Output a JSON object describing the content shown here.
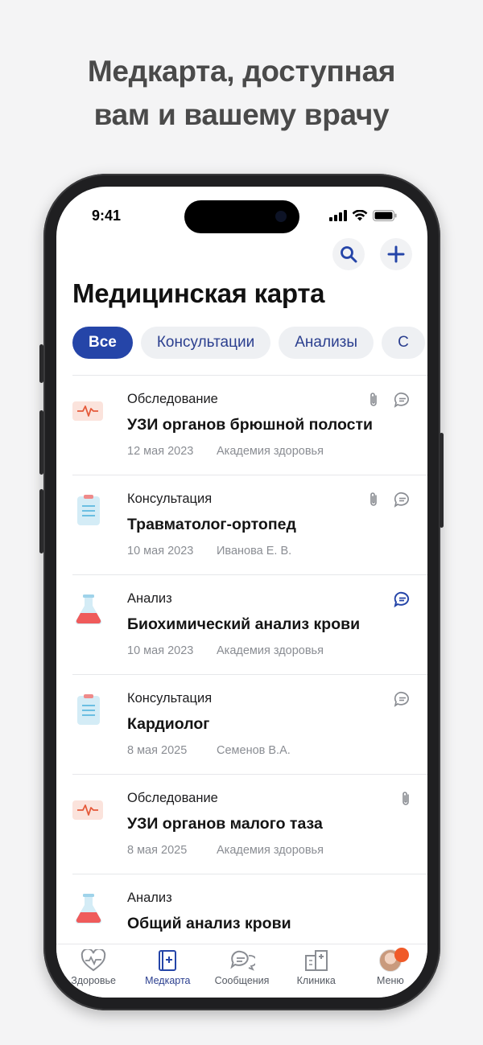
{
  "headline": {
    "line1": "Медкарта, доступная",
    "line2": "вам и вашему врачу"
  },
  "status": {
    "time": "9:41"
  },
  "header": {
    "title": "Медицинская карта"
  },
  "filters": [
    {
      "label": "Все",
      "active": true
    },
    {
      "label": "Консультации",
      "active": false
    },
    {
      "label": "Анализы",
      "active": false
    },
    {
      "label": "С",
      "active": false
    }
  ],
  "records": [
    {
      "type": "exam",
      "category": "Обследование",
      "title": "УЗИ органов брюшной полости",
      "date": "12 мая 2023",
      "source": "Академия здоровья",
      "attachment": true,
      "comment": true,
      "comment_active": false
    },
    {
      "type": "consultation",
      "category": "Консультация",
      "title": "Травматолог-ортопед",
      "date": "10 мая 2023",
      "source": "Иванова Е. В.",
      "attachment": true,
      "comment": true,
      "comment_active": false
    },
    {
      "type": "analysis",
      "category": "Анализ",
      "title": "Биохимический анализ крови",
      "date": "10 мая 2023",
      "source": "Академия здоровья",
      "attachment": false,
      "comment": true,
      "comment_active": true
    },
    {
      "type": "consultation",
      "category": "Консультация",
      "title": "Кардиолог",
      "date": "8 мая 2025",
      "source": "Семенов В.А.",
      "attachment": false,
      "comment": true,
      "comment_active": false
    },
    {
      "type": "exam",
      "category": "Обследование",
      "title": "УЗИ органов малого таза",
      "date": "8 мая 2025",
      "source": "Академия здоровья",
      "attachment": true,
      "comment": false,
      "comment_active": false
    },
    {
      "type": "analysis",
      "category": "Анализ",
      "title": "Общий анализ крови",
      "date": "",
      "source": "",
      "attachment": false,
      "comment": false,
      "comment_active": false
    }
  ],
  "tabbar": [
    {
      "label": "Здоровье",
      "icon": "heart-pulse-icon",
      "active": false
    },
    {
      "label": "Медкарта",
      "icon": "medical-book-icon",
      "active": true
    },
    {
      "label": "Сообщения",
      "icon": "chat-icon",
      "active": false
    },
    {
      "label": "Клиника",
      "icon": "clinic-building-icon",
      "active": false
    },
    {
      "label": "Меню",
      "icon": "avatar",
      "active": false,
      "badge": true
    }
  ],
  "colors": {
    "accent": "#2545a8",
    "exam": "#fbe3dc",
    "consultation": "#d4ecf6",
    "analysis": "#ef5b5b",
    "badge": "#f05a28"
  }
}
